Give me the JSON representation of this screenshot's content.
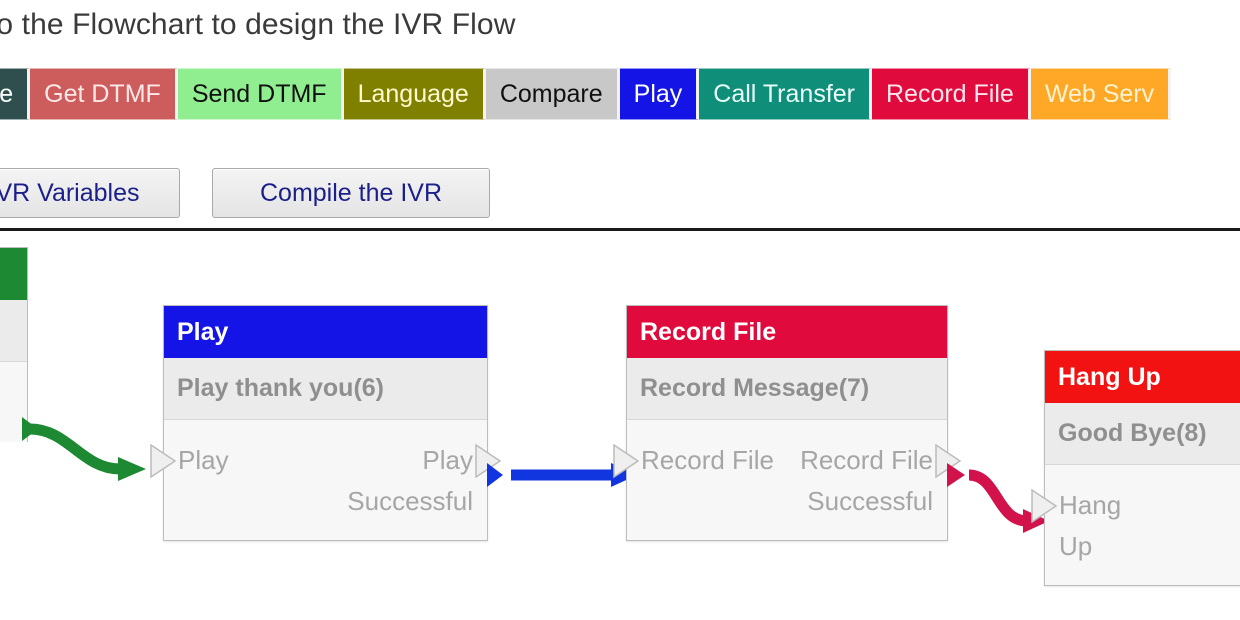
{
  "header": {
    "title": "to the Flowchart to design the IVR Flow"
  },
  "toolbar": {
    "tabs": [
      {
        "label": "ree",
        "bg": "#2f4f4f",
        "fg": "#ffffff"
      },
      {
        "label": "Get DTMF",
        "bg": "#cd5c5c",
        "fg": "#ffe8e8"
      },
      {
        "label": "Send DTMF",
        "bg": "#90ee90",
        "fg": "#101010"
      },
      {
        "label": "Language",
        "bg": "#808000",
        "fg": "#fffacd"
      },
      {
        "label": "Compare",
        "bg": "#c8c8c8",
        "fg": "#101010"
      },
      {
        "label": "Play",
        "bg": "#1414e6",
        "fg": "#ffffff"
      },
      {
        "label": "Call Transfer",
        "bg": "#0f8f7a",
        "fg": "#eafff9"
      },
      {
        "label": "Record File",
        "bg": "#e00a3c",
        "fg": "#ffe6ee"
      },
      {
        "label": "Web Serv",
        "bg": "#ffa726",
        "fg": "#fff3d0"
      }
    ]
  },
  "actions": {
    "ivr_variables": "IVR Variables",
    "compile_ivr": "Compile the IVR"
  },
  "flow": {
    "nodes": [
      {
        "id": "play",
        "title": "Play",
        "subtitle": "Play thank you(6)",
        "port_in": "Play",
        "port_out": "Play Successful",
        "header_color": "#1414e6"
      },
      {
        "id": "record-file",
        "title": "Record File",
        "subtitle": "Record Message(7)",
        "port_in": "Record File",
        "port_out": "Record File Successful",
        "header_color": "#e00a3c"
      },
      {
        "id": "hang-up",
        "title": "Hang Up",
        "subtitle": "Good Bye(8)",
        "port_in": "Hang Up",
        "port_out": "",
        "header_color": "#f21212"
      }
    ],
    "connectors": [
      {
        "id": "green-to-play",
        "color": "#1d8a33"
      },
      {
        "id": "play-to-record",
        "color": "#1136e0"
      },
      {
        "id": "record-to-hangup",
        "color": "#d2124a"
      }
    ]
  }
}
